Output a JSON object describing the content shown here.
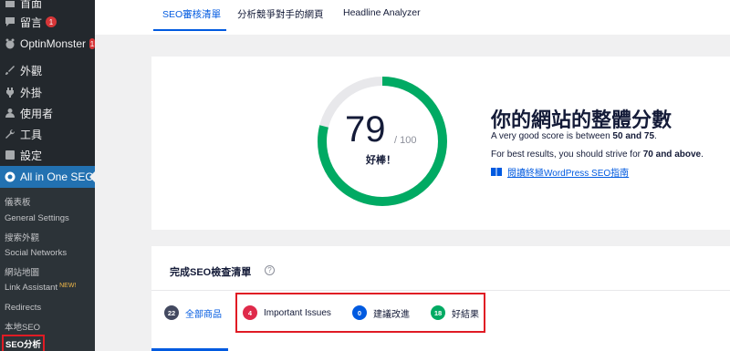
{
  "sidebar": {
    "top_partial": "首面",
    "items": [
      {
        "label": "留言",
        "icon": "comment-icon",
        "badge": "1"
      },
      {
        "label": "OptinMonster",
        "icon": "optinmonster-icon",
        "badge": "1"
      },
      {
        "label": "外觀",
        "icon": "paintbrush-icon"
      },
      {
        "label": "外掛",
        "icon": "plugin-icon"
      },
      {
        "label": "使用者",
        "icon": "user-icon"
      },
      {
        "label": "工具",
        "icon": "wrench-icon"
      },
      {
        "label": "設定",
        "icon": "settings-icon"
      },
      {
        "label": "All in One SEO",
        "icon": "aioseo-icon"
      }
    ],
    "submenu": [
      {
        "label": "儀表板"
      },
      {
        "label": "General Settings"
      },
      {
        "label": "搜索外觀"
      },
      {
        "label": "Social Networks"
      },
      {
        "label": "網站地圖"
      },
      {
        "label": "Link Assistant",
        "new": "NEW!"
      },
      {
        "label": "Redirects"
      },
      {
        "label": "本地SEO"
      },
      {
        "label": "SEO分析"
      }
    ]
  },
  "tabs": [
    {
      "label": "SEO審核清單"
    },
    {
      "label": "分析競爭對手的網頁"
    },
    {
      "label": "Headline Analyzer"
    }
  ],
  "score": {
    "value": "79",
    "max": "/ 100",
    "fraction": 0.79,
    "word": "好棒！",
    "title": "你的網站的整體分數",
    "desc1_prefix": "A very good score is between ",
    "desc1_bold": "50 and 75",
    "desc1_suffix": ".",
    "desc2_prefix": "For best results, you should strive for ",
    "desc2_bold": "70 and above",
    "desc2_suffix": ".",
    "guide_link": "閱讀終極WordPress SEO指南",
    "colors": {
      "gauge": "#00aa63",
      "track": "#e8e8eb"
    }
  },
  "checklist": {
    "title": "完成SEO檢查清單",
    "tabs": [
      {
        "count": "22",
        "label": "全部商品",
        "color": "#434960"
      },
      {
        "count": "4",
        "label": "Important Issues",
        "color": "#df2a4a"
      },
      {
        "count": "0",
        "label": "建議改進",
        "color": "#005ae0"
      },
      {
        "count": "18",
        "label": "好結果",
        "color": "#00aa63"
      }
    ]
  }
}
